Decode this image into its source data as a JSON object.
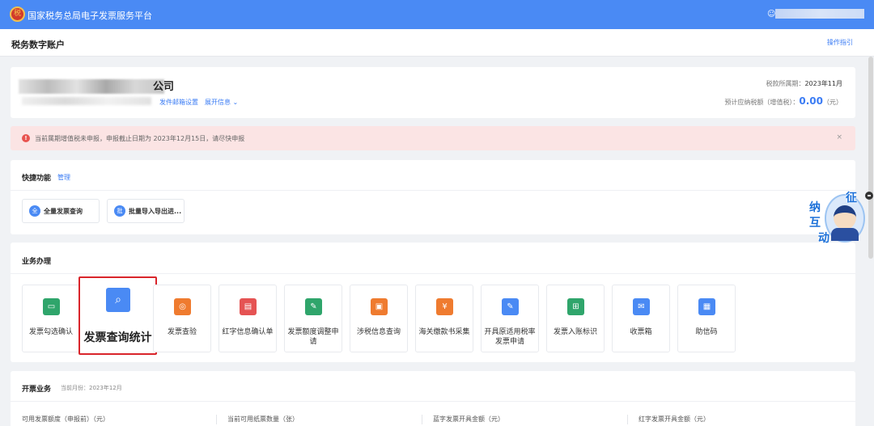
{
  "header": {
    "title": "国家税务总局电子发票服务平台",
    "user_icon": "user-icon"
  },
  "subheader": {
    "page_title": "税务数字账户",
    "guide_link": "操作指引"
  },
  "company": {
    "name_suffix": "公司",
    "email_setting": "发件邮箱设置",
    "expand_info": "展开信息",
    "period_label": "税款所属期：",
    "period_value": "2023年11月",
    "estimate_label": "预计应纳税额（增值税）：",
    "estimate_amount": "0.00",
    "estimate_unit": "（元）"
  },
  "alert": {
    "message": "当前属期增值税未申报，申报截止日期为 2023年12月15日，请尽快申报",
    "close": "×"
  },
  "quick": {
    "title": "快捷功能",
    "manage": "管理",
    "buttons": [
      {
        "icon_char": "全",
        "label": "全量发票查询"
      },
      {
        "icon_char": "批",
        "label": "批量导入导出进..."
      }
    ]
  },
  "business": {
    "title": "业务办理",
    "tiles": [
      {
        "label": "发票勾选确认",
        "icon": "ticket-icon",
        "glyph": "▭",
        "color": "#2fa56b"
      },
      {
        "label": "发票查询统计",
        "icon": "search-document-icon",
        "glyph": "⌕",
        "color": "#4a8af4"
      },
      {
        "label": "发票查验",
        "icon": "verify-icon",
        "glyph": "◎",
        "color": "#ef7b2f"
      },
      {
        "label": "红字信息确认单",
        "icon": "red-invoice-icon",
        "glyph": "▤",
        "color": "#e55353"
      },
      {
        "label": "发票额度调整申请",
        "icon": "quota-edit-icon",
        "glyph": "✎",
        "color": "#2fa56b"
      },
      {
        "label": "涉税信息查询",
        "icon": "tax-info-icon",
        "glyph": "▣",
        "color": "#ef7b2f"
      },
      {
        "label": "海关缴款书采集",
        "icon": "customs-icon",
        "glyph": "¥",
        "color": "#ef7b2f"
      },
      {
        "label": "开具原适用税率发票申请",
        "icon": "rate-apply-icon",
        "glyph": "✎",
        "color": "#4a8af4"
      },
      {
        "label": "发票入账标识",
        "icon": "book-entry-icon",
        "glyph": "⊞",
        "color": "#2fa56b"
      },
      {
        "label": "收票箱",
        "icon": "mail-icon",
        "glyph": "✉",
        "color": "#4a8af4"
      },
      {
        "label": "助信码",
        "icon": "qr-code-icon",
        "glyph": "▦",
        "color": "#4a8af4"
      }
    ]
  },
  "invoicing": {
    "title": "开票业务",
    "month_label": "当前月份：",
    "month_value": "2023年12月",
    "stats": [
      "可用发票额度（申报前）（元）",
      "当前可用纸票数量（张）",
      "蓝字发票开具金额（元）",
      "红字发票开具金额（元）"
    ]
  },
  "mascot": {
    "chars": [
      "征",
      "纳",
      "互",
      "动"
    ]
  }
}
